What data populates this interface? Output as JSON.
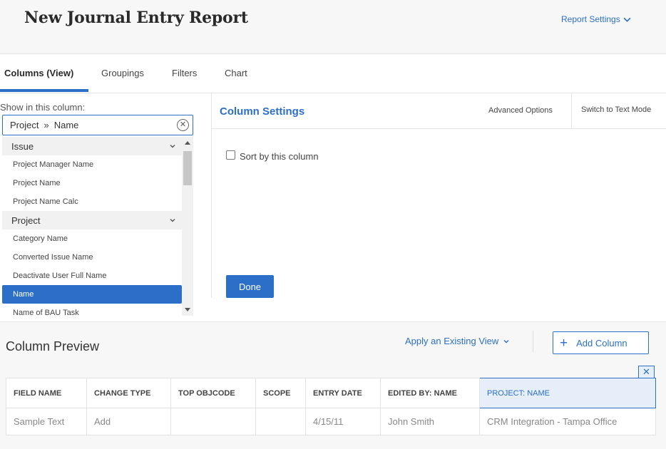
{
  "header": {
    "title": "New Journal Entry Report",
    "report_settings": "Report Settings"
  },
  "tabs": [
    {
      "label": "Columns (View)",
      "active": true
    },
    {
      "label": "Groupings",
      "active": false
    },
    {
      "label": "Filters",
      "active": false
    },
    {
      "label": "Chart",
      "active": false
    }
  ],
  "field_picker": {
    "label": "Show in this column:",
    "value_object": "Project",
    "value_field": "Name",
    "groups": [
      {
        "label": "Issue",
        "items": [
          "Project Manager Name",
          "Project Name",
          "Project Name Calc"
        ]
      },
      {
        "label": "Project",
        "items": [
          "Category Name",
          "Converted Issue Name",
          "Deactivate User Full Name",
          "Name",
          "Name of BAU Task"
        ]
      }
    ],
    "selected_item": "Name"
  },
  "column_settings": {
    "title": "Column Settings",
    "advanced_options": "Advanced Options",
    "switch_text_mode": "Switch to Text Mode",
    "sort_label": "Sort by this column",
    "sort_checked": false,
    "done_label": "Done"
  },
  "preview": {
    "title": "Column Preview",
    "apply_view": "Apply an Existing View",
    "add_column": "Add Column",
    "remove_label": "✕",
    "columns": [
      "FIELD NAME",
      "CHANGE TYPE",
      "TOP OBJCODE",
      "SCOPE",
      "ENTRY DATE",
      "EDITED BY: NAME",
      "PROJECT: NAME"
    ],
    "row": [
      "Sample Text",
      "Add",
      "",
      "",
      "4/15/11",
      "John Smith",
      "CRM Integration - Tampa Office"
    ],
    "selected_column": "PROJECT: NAME"
  },
  "colors": {
    "accent": "#2c6fc9",
    "selected_column_bg": "#e5eef9"
  }
}
